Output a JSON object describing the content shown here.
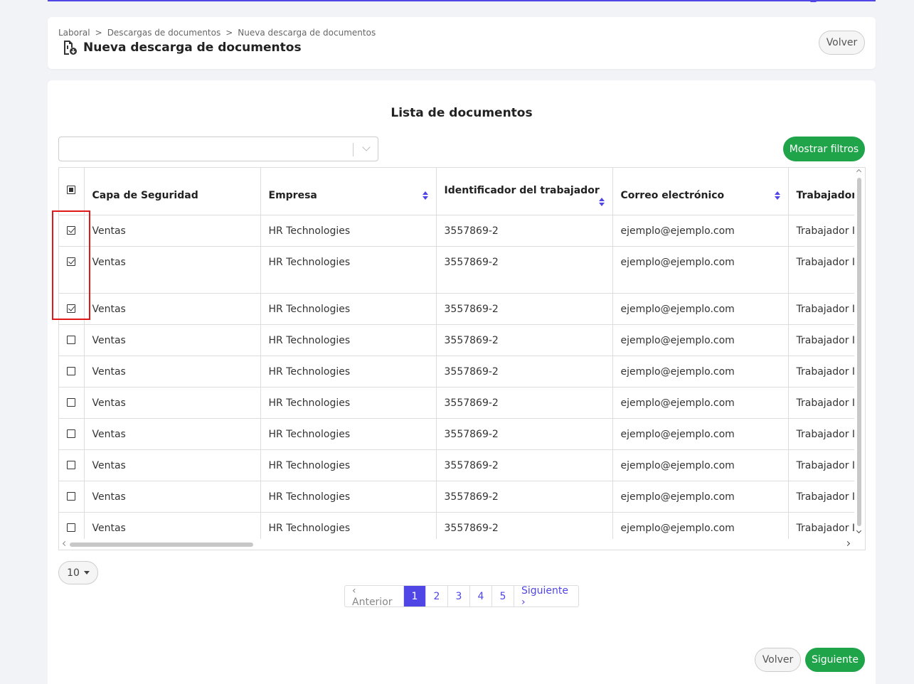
{
  "breadcrumb": [
    "Laboral",
    "Descargas de documentos",
    "Nueva descarga de documentos"
  ],
  "breadcrumb_separator": ">",
  "page_title": "Nueva descarga de documentos",
  "header_back_label": "Volver",
  "list_title": "Lista de documentos",
  "search_select": {
    "value": ""
  },
  "show_filters_label": "Mostrar filtros",
  "table": {
    "columns": [
      "Capa de Seguridad",
      "Empresa",
      "Identificador del trabajador",
      "Correo electrónico",
      "Trabajador"
    ],
    "sortable": [
      false,
      true,
      true,
      true,
      false
    ],
    "rows": [
      {
        "checked": true,
        "cells": [
          "Ventas",
          "HR Technologies",
          "3557869-2",
          "ejemplo@ejemplo.com",
          "Trabajador Ic"
        ]
      },
      {
        "checked": true,
        "cells": [
          "Ventas",
          "HR Technologies",
          "3557869-2",
          "ejemplo@ejemplo.com",
          "Trabajador Ic"
        ]
      },
      {
        "checked": true,
        "cells": [
          "Ventas",
          "HR Technologies",
          "3557869-2",
          "ejemplo@ejemplo.com",
          "Trabajador Ic"
        ]
      },
      {
        "checked": false,
        "cells": [
          "Ventas",
          "HR Technologies",
          "3557869-2",
          "ejemplo@ejemplo.com",
          "Trabajador Ic"
        ]
      },
      {
        "checked": false,
        "cells": [
          "Ventas",
          "HR Technologies",
          "3557869-2",
          "ejemplo@ejemplo.com",
          "Trabajador Ic"
        ]
      },
      {
        "checked": false,
        "cells": [
          "Ventas",
          "HR Technologies",
          "3557869-2",
          "ejemplo@ejemplo.com",
          "Trabajador Ic"
        ]
      },
      {
        "checked": false,
        "cells": [
          "Ventas",
          "HR Technologies",
          "3557869-2",
          "ejemplo@ejemplo.com",
          "Trabajador Ic"
        ]
      },
      {
        "checked": false,
        "cells": [
          "Ventas",
          "HR Technologies",
          "3557869-2",
          "ejemplo@ejemplo.com",
          "Trabajador Ic"
        ]
      },
      {
        "checked": false,
        "cells": [
          "Ventas",
          "HR Technologies",
          "3557869-2",
          "ejemplo@ejemplo.com",
          "Trabajador Ic"
        ]
      },
      {
        "checked": false,
        "cells": [
          "Ventas",
          "HR Technologies",
          "3557869-2",
          "ejemplo@ejemplo.com",
          "Trabajador Ic"
        ]
      }
    ]
  },
  "per_page": "10",
  "pagination": {
    "prev_label": "‹ Anterior",
    "pages": [
      "1",
      "2",
      "3",
      "4",
      "5"
    ],
    "active_page": "1",
    "next_label": "Siguiente ›"
  },
  "footer": {
    "back_label": "Volver",
    "next_label": "Siguiente"
  },
  "colors": {
    "accent": "#5046e5",
    "success": "#1fa44a",
    "highlight": "#e01818"
  },
  "icons": [
    "document-download-icon",
    "chevron-down-icon",
    "sort-icon"
  ]
}
